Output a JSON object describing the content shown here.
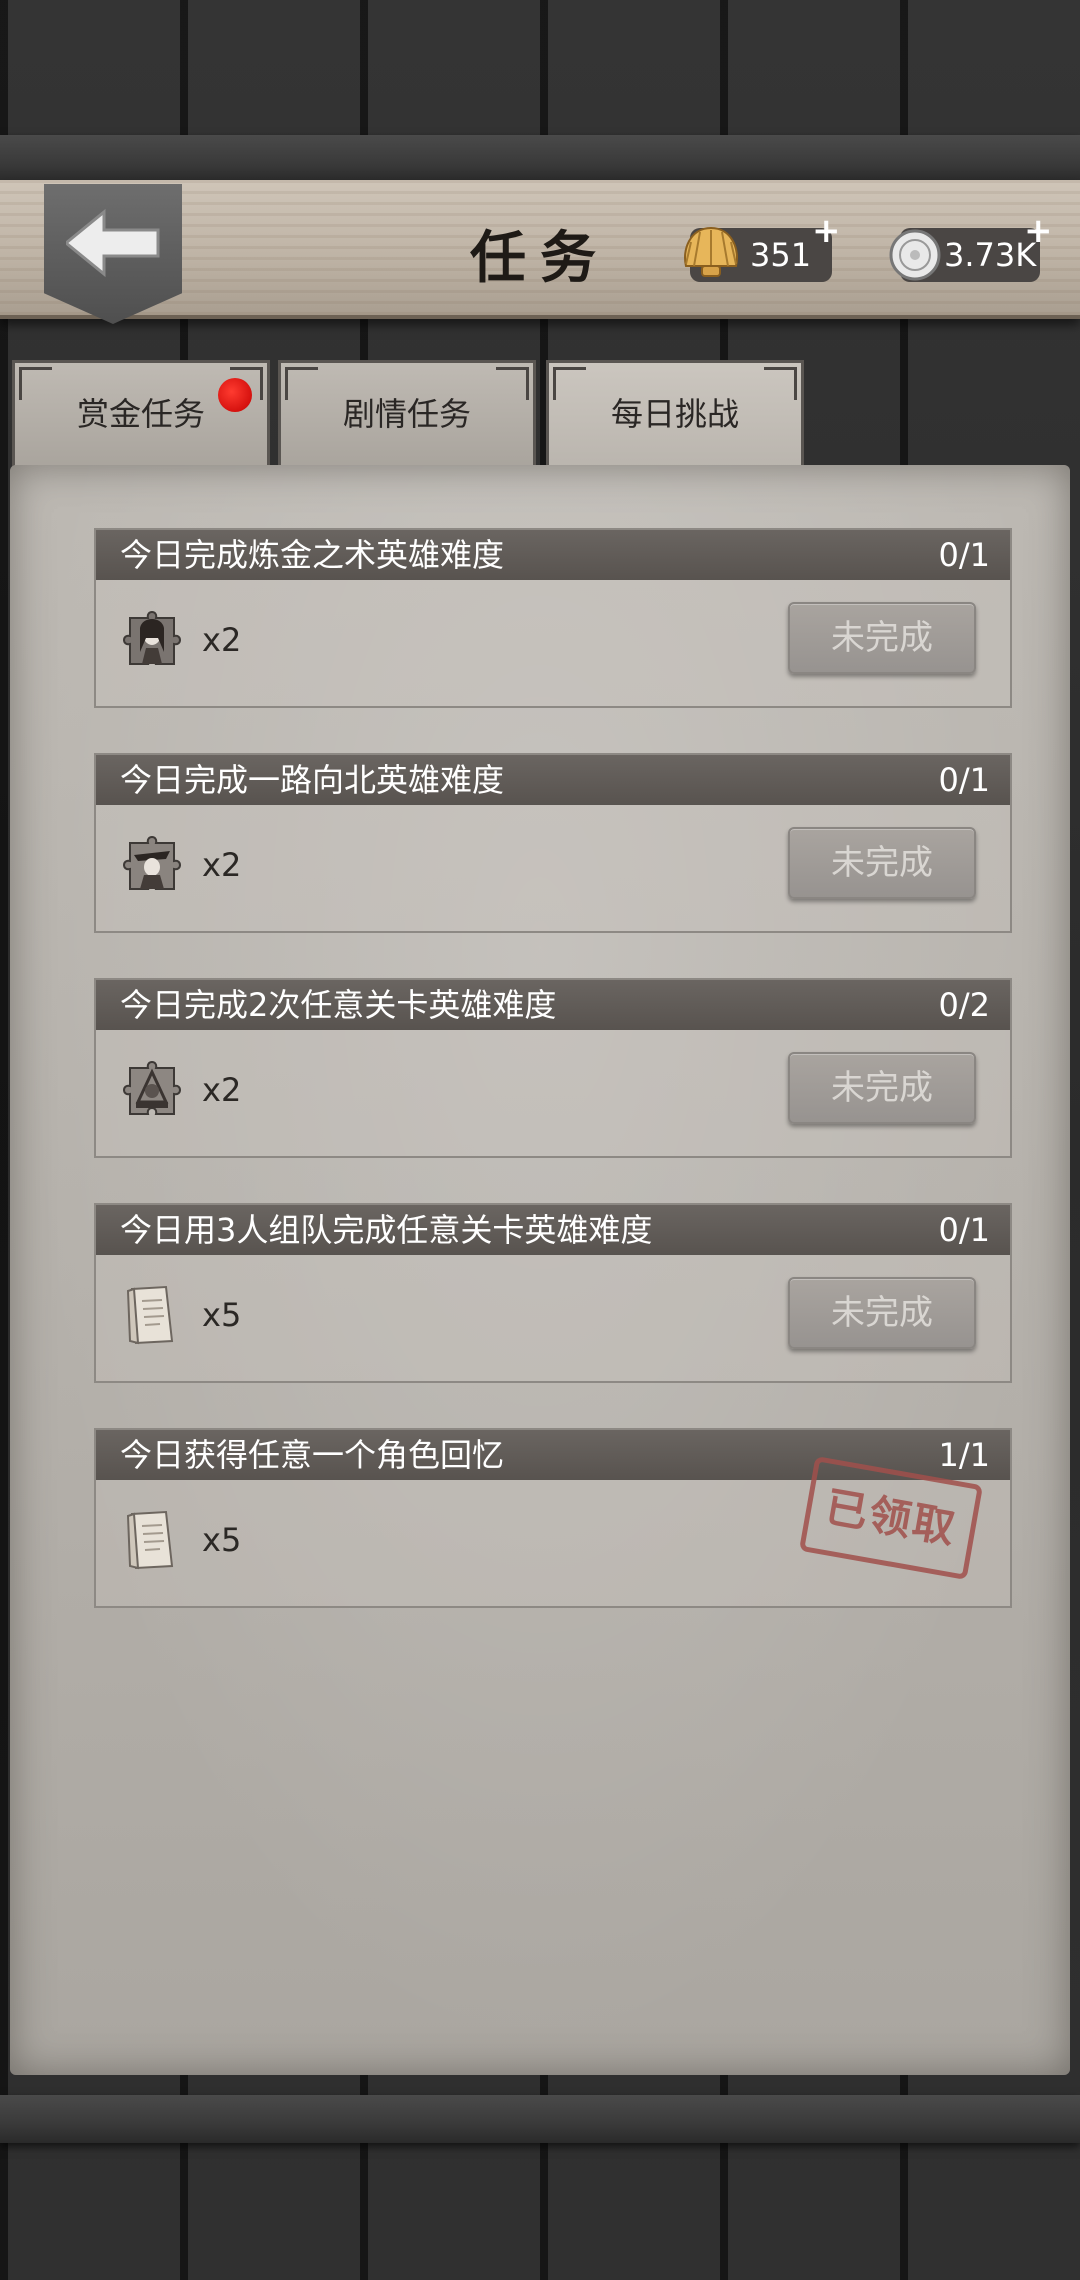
{
  "header": {
    "title": "任务",
    "shell_currency": "351",
    "coin_currency": "3.73K",
    "plus_symbol": "+"
  },
  "tabs": [
    {
      "label": "赏金任务",
      "has_badge": true
    },
    {
      "label": "剧情任务",
      "has_badge": false
    },
    {
      "label": "每日挑战",
      "active": true
    }
  ],
  "tasks": [
    {
      "title": "今日完成炼金之术英雄难度",
      "progress": "0/1",
      "reward_icon": "character-puzzle-icon",
      "reward_count": "x2",
      "status": "未完成"
    },
    {
      "title": "今日完成一路向北英雄难度",
      "progress": "0/1",
      "reward_icon": "character-puzzle-icon",
      "reward_count": "x2",
      "status": "未完成"
    },
    {
      "title": "今日完成2次任意关卡英雄难度",
      "progress": "0/2",
      "reward_icon": "emblem-puzzle-icon",
      "reward_count": "x2",
      "status": "未完成"
    },
    {
      "title": "今日用3人组队完成任意关卡英雄难度",
      "progress": "0/1",
      "reward_icon": "scroll-paper-icon",
      "reward_count": "x5",
      "status": "未完成"
    },
    {
      "title": "今日获得任意一个角色回忆",
      "progress": "1/1",
      "reward_icon": "scroll-paper-icon",
      "reward_count": "x5",
      "status": "已领取"
    }
  ],
  "colors": {
    "badge": "#e00000",
    "stamp": "#a1504c",
    "task_header": "#5f5a56"
  }
}
